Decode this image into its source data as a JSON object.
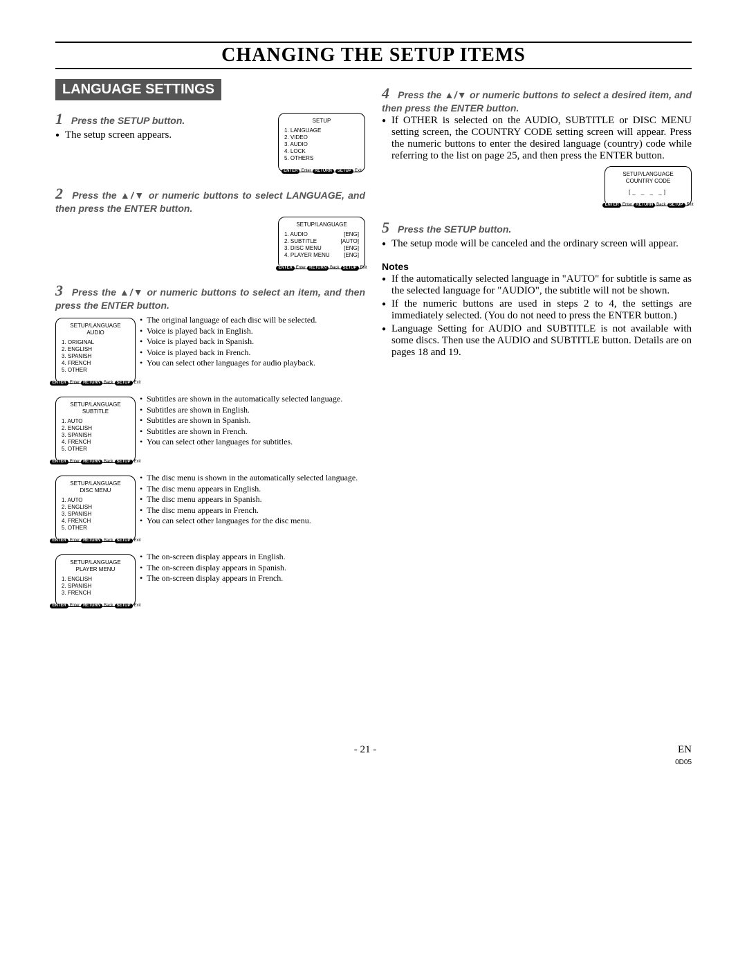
{
  "page": {
    "title": "CHANGING THE SETUP ITEMS",
    "section": "LANGUAGE SETTINGS",
    "page_number": "- 21 -",
    "lang_code": "EN",
    "doc_code": "0D05"
  },
  "steps": {
    "s1": {
      "num": "1",
      "head": "Press the SETUP button.",
      "body": "The setup screen appears."
    },
    "s2": {
      "num": "2",
      "head": "Press the ▲/▼ or numeric buttons to select LANGUAGE, and then press the ENTER button."
    },
    "s3": {
      "num": "3",
      "head": "Press the ▲/▼ or numeric buttons to select an item, and then press the ENTER button."
    },
    "s4": {
      "num": "4",
      "head": "Press the ▲/▼ or numeric buttons to select a desired item, and then press the ENTER button.",
      "body": "If OTHER is selected on the AUDIO, SUBTITLE or DISC MENU setting screen, the COUNTRY CODE setting screen will appear. Press the numeric buttons to enter the desired language (country) code while referring to the list on page 25, and then press the ENTER button."
    },
    "s5": {
      "num": "5",
      "head": "Press the SETUP button.",
      "body": "The setup mode will be canceled and the ordinary screen will appear."
    }
  },
  "notes": {
    "heading": "Notes",
    "items": [
      "If the automatically selected language in \"AUTO\" for subtitle is same as the selected language for \"AUDIO\", the subtitle will not be shown.",
      "If the numeric buttons are used in steps 2 to 4, the settings are immediately selected. (You do not need to press the ENTER button.)",
      "Language Setting for AUDIO and SUBTITLE is not available with some discs. Then use the AUDIO and SUBTITLE button. Details are on pages 18 and 19."
    ]
  },
  "osd": {
    "footer": {
      "enter": "ENTER",
      "enter_t": "Enter",
      "return": "RETURN",
      "back": "Back",
      "setup": "SETUP",
      "setup_t": "Exit"
    },
    "setup": {
      "title": "SETUP",
      "items": [
        "1. LANGUAGE",
        "2. VIDEO",
        "3. AUDIO",
        "4. LOCK",
        "5. OTHERS"
      ]
    },
    "lang": {
      "title": "SETUP/LANGUAGE",
      "rows": [
        {
          "l": "1. AUDIO",
          "r": "[ENG]"
        },
        {
          "l": "2. SUBTITLE",
          "r": "[AUTO]"
        },
        {
          "l": "3. DISC MENU",
          "r": "[ENG]"
        },
        {
          "l": "4. PLAYER MENU",
          "r": "[ENG]"
        }
      ]
    },
    "audio": {
      "title1": "SETUP/LANGUAGE",
      "title2": "AUDIO",
      "items": [
        "1. ORIGINAL",
        "2. ENGLISH",
        "3. SPANISH",
        "4. FRENCH",
        "5. OTHER"
      ],
      "desc": [
        "The original language of each disc will be selected.",
        "Voice is played back in English.",
        "Voice is played back in Spanish.",
        "Voice is played back in French.",
        "You can select other languages for audio playback."
      ]
    },
    "subtitle": {
      "title1": "SETUP/LANGUAGE",
      "title2": "SUBTITLE",
      "items": [
        "1. AUTO",
        "2. ENGLISH",
        "3. SPANISH",
        "4. FRENCH",
        "5. OTHER"
      ],
      "desc": [
        "Subtitles are shown in the automatically selected language.",
        "Subtitles are shown in English.",
        "Subtitles are shown in Spanish.",
        "Subtitles are shown in French.",
        "You can select other languages for subtitles."
      ]
    },
    "discmenu": {
      "title1": "SETUP/LANGUAGE",
      "title2": "DISC MENU",
      "items": [
        "1. AUTO",
        "2. ENGLISH",
        "3. SPANISH",
        "4. FRENCH",
        "5. OTHER"
      ],
      "desc": [
        "The disc menu is shown in the automatically selected language.",
        "The disc menu appears in English.",
        "The disc menu appears in Spanish.",
        "The disc menu appears in French.",
        "You can select other languages for the disc menu."
      ]
    },
    "playermenu": {
      "title1": "SETUP/LANGUAGE",
      "title2": "PLAYER MENU",
      "items": [
        "1. ENGLISH",
        "2. SPANISH",
        "3. FRENCH"
      ],
      "desc": [
        "The on-screen display appears in English.",
        "The on-screen display appears in Spanish.",
        "The on-screen display appears in French."
      ]
    },
    "country": {
      "title1": "SETUP/LANGUAGE",
      "title2": "COUNTRY CODE",
      "input": "[_ _ _ _]"
    }
  }
}
